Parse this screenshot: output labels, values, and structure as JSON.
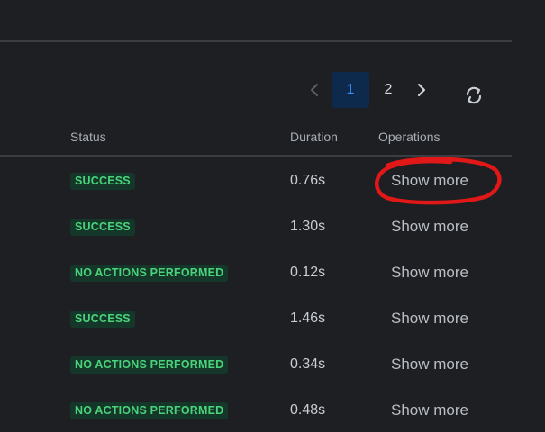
{
  "pagination": {
    "pages": [
      "1",
      "2"
    ],
    "active_page": "1",
    "prev_icon": "chevron-left-icon",
    "next_icon": "chevron-right-icon",
    "refresh_icon": "refresh-icon"
  },
  "table": {
    "headers": {
      "status": "Status",
      "duration": "Duration",
      "operations": "Operations"
    },
    "rows": [
      {
        "status": "SUCCESS",
        "duration": "0.76s",
        "operations": "Show more"
      },
      {
        "status": "SUCCESS",
        "duration": "1.30s",
        "operations": "Show more"
      },
      {
        "status": "NO ACTIONS PERFORMED",
        "duration": "0.12s",
        "operations": "Show more"
      },
      {
        "status": "SUCCESS",
        "duration": "1.46s",
        "operations": "Show more"
      },
      {
        "status": "NO ACTIONS PERFORMED",
        "duration": "0.34s",
        "operations": "Show more"
      },
      {
        "status": "NO ACTIONS PERFORMED",
        "duration": "0.48s",
        "operations": "Show more"
      }
    ]
  },
  "colors": {
    "background": "#1e1f23",
    "badge_bg": "#14372a",
    "badge_text": "#4ad37a",
    "active_page_bg": "#0d2a4c",
    "active_page_text": "#3b8df0",
    "annotation": "#e01818"
  },
  "annotation": {
    "shape": "hand-drawn-circle",
    "target": "first-row-show-more"
  }
}
